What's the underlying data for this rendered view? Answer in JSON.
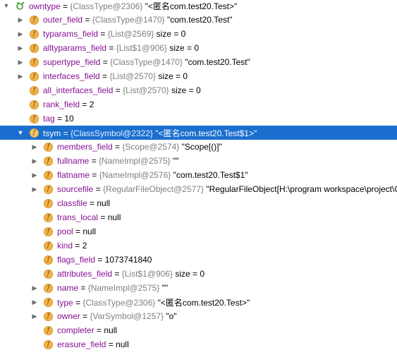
{
  "rows": [
    {
      "name": "owntype",
      "sep": " = ",
      "ref": "{ClassType@2306}",
      "val": " \"<匿名com.test20.Test>\"",
      "expand": "down",
      "icon": "watch-root-icon"
    },
    {
      "name": "outer_field",
      "sep": " = ",
      "ref": "{ClassType@1470}",
      "val": " \"com.test20.Test\"",
      "expand": "right",
      "icon": "field-icon"
    },
    {
      "name": "typarams_field",
      "sep": " = ",
      "ref": "{List@2569}",
      "val": "  size = 0",
      "expand": "right",
      "icon": "field-icon"
    },
    {
      "name": "alltyparams_field",
      "sep": " = ",
      "ref": "{List$1@906}",
      "val": "  size = 0",
      "expand": "right",
      "icon": "field-icon"
    },
    {
      "name": "supertype_field",
      "sep": " = ",
      "ref": "{ClassType@1470}",
      "val": " \"com.test20.Test\"",
      "expand": "right",
      "icon": "field-icon"
    },
    {
      "name": "interfaces_field",
      "sep": " = ",
      "ref": "{List@2570}",
      "val": "  size = 0",
      "expand": "right",
      "icon": "field-icon"
    },
    {
      "name": "all_interfaces_field",
      "sep": " = ",
      "ref": "{List@2570}",
      "val": "  size = 0",
      "expand": "right",
      "icon": "field-icon"
    },
    {
      "name": "rank_field",
      "sep": " = ",
      "ref": "",
      "val": "2",
      "expand": "none",
      "icon": "field-icon"
    },
    {
      "name": "tag",
      "sep": " = ",
      "ref": "",
      "val": "10",
      "expand": "none",
      "icon": "field-icon"
    },
    {
      "name": "tsym",
      "sep": " = ",
      "ref": "{ClassSymbol@2322}",
      "val": " \"<匿名com.test20.Test$1>\"",
      "expand": "down",
      "icon": "field-icon",
      "selected": true
    },
    {
      "name": "members_field",
      "sep": " = ",
      "ref": "{Scope@2574}",
      "val": " \"Scope[()]\"",
      "expand": "right",
      "icon": "field-icon"
    },
    {
      "name": "fullname",
      "sep": " = ",
      "ref": "{NameImpl@2575}",
      "val": " \"\"",
      "expand": "right",
      "icon": "field-icon"
    },
    {
      "name": "flatname",
      "sep": " = ",
      "ref": "{NameImpl@2576}",
      "val": " \"com.test20.Test$1\"",
      "expand": "right",
      "icon": "field-icon"
    },
    {
      "name": "sourcefile",
      "sep": " = ",
      "ref": "{RegularFileObject@2577}",
      "val": " \"RegularFileObject[H:\\program workspace\\project\\C",
      "expand": "right",
      "icon": "field-icon"
    },
    {
      "name": "classfile",
      "sep": " = ",
      "ref": "",
      "val": "null",
      "expand": "none",
      "icon": "field-icon"
    },
    {
      "name": "trans_local",
      "sep": " = ",
      "ref": "",
      "val": "null",
      "expand": "none",
      "icon": "field-icon"
    },
    {
      "name": "pool",
      "sep": " = ",
      "ref": "",
      "val": "null",
      "expand": "none",
      "icon": "field-icon"
    },
    {
      "name": "kind",
      "sep": " = ",
      "ref": "",
      "val": "2",
      "expand": "none",
      "icon": "field-icon"
    },
    {
      "name": "flags_field",
      "sep": " = ",
      "ref": "",
      "val": "1073741840",
      "expand": "none",
      "icon": "field-icon"
    },
    {
      "name": "attributes_field",
      "sep": " = ",
      "ref": "{List$1@906}",
      "val": "  size = 0",
      "expand": "right",
      "icon": "field-icon"
    },
    {
      "name": "name",
      "sep": " = ",
      "ref": "{NameImpl@2575}",
      "val": " \"\"",
      "expand": "right",
      "icon": "field-icon"
    },
    {
      "name": "type",
      "sep": " = ",
      "ref": "{ClassType@2306}",
      "val": " \"<匿名com.test20.Test>\"",
      "expand": "right",
      "icon": "field-icon"
    },
    {
      "name": "owner",
      "sep": " = ",
      "ref": "{VarSymbol@1257}",
      "val": " \"o\"",
      "expand": "right",
      "icon": "field-icon"
    },
    {
      "name": "completer",
      "sep": " = ",
      "ref": "",
      "val": "null",
      "expand": "none",
      "icon": "field-icon"
    },
    {
      "name": "erasure_field",
      "sep": " = ",
      "ref": "",
      "val": "null",
      "expand": "none",
      "icon": "field-icon"
    }
  ],
  "badge_letter": "f",
  "colors": {
    "selection": "#1a6fcf",
    "field_name": "#871094",
    "ref": "#808080",
    "badge": "#f0b34a"
  }
}
